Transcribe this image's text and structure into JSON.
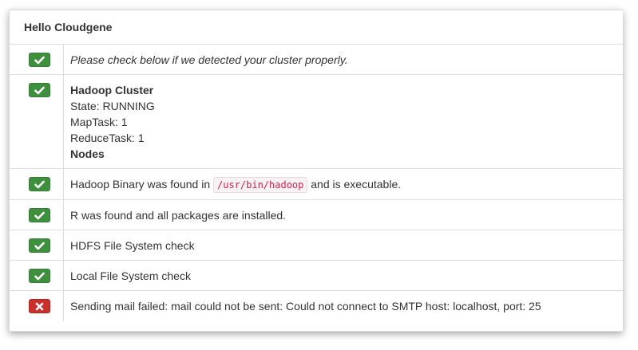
{
  "panel": {
    "title": "Hello Cloudgene"
  },
  "rows": [
    {
      "status": "ok",
      "icon": "check-icon",
      "text": "Please check below if we detected your cluster properly."
    },
    {
      "status": "ok",
      "icon": "check-icon",
      "cluster_title": "Hadoop Cluster",
      "state": "State: RUNNING",
      "map_task": "MapTask: 1",
      "reduce_task": "ReduceTask: 1",
      "nodes_label": "Nodes"
    },
    {
      "status": "ok",
      "icon": "check-icon",
      "text_before": "Hadoop Binary was found in",
      "path": "/usr/bin/hadoop",
      "text_after": "and is executable."
    },
    {
      "status": "ok",
      "icon": "check-icon",
      "text": "R was found and all packages are installed."
    },
    {
      "status": "ok",
      "icon": "check-icon",
      "text": "HDFS File System check"
    },
    {
      "status": "ok",
      "icon": "check-icon",
      "text": "Local File System check"
    },
    {
      "status": "error",
      "icon": "cross-icon",
      "text": "Sending mail failed: mail could not be sent: Could not connect to SMTP host: localhost, port: 25"
    }
  ],
  "colors": {
    "ok": "#3e8f3e",
    "error": "#c9302c",
    "code_text": "#c7254e",
    "code_bg": "#f9f2f4"
  }
}
